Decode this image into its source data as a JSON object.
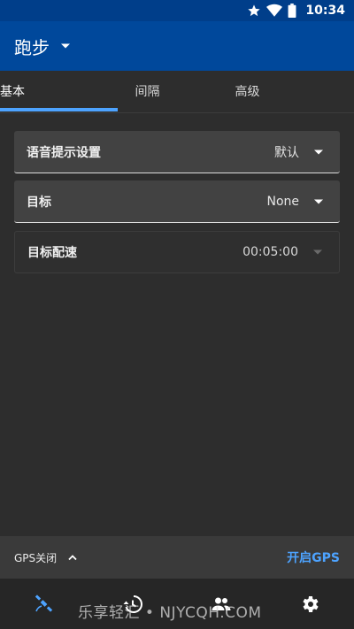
{
  "status_bar": {
    "time": "10:34",
    "icons": [
      "star-icon",
      "wifi-icon",
      "battery-icon"
    ]
  },
  "app_bar": {
    "title": "跑步",
    "caret_icon": "caret-down-icon"
  },
  "tabs": [
    {
      "label": "基本",
      "active": true
    },
    {
      "label": "间隔",
      "active": false
    },
    {
      "label": "高级",
      "active": false
    }
  ],
  "settings": [
    {
      "label": "语音提示设置",
      "value": "默认",
      "enabled": true
    },
    {
      "label": "目标",
      "value": "None",
      "enabled": true
    },
    {
      "label": "目标配速",
      "value": "00:05:00",
      "enabled": false
    }
  ],
  "gps_bar": {
    "status": "GPS关闭",
    "enable_label": "开启GPS"
  },
  "bottom_nav": {
    "items": [
      "satellite-icon",
      "history-icon",
      "people-icon",
      "settings-gear-icon"
    ]
  },
  "watermark": "乐享轻汇 • NJYCQH.COM",
  "colors": {
    "status_bar": "#003e8a",
    "app_bar": "#00489b",
    "accent": "#4da3ff",
    "background": "#2d2d2d",
    "card": "#424242"
  }
}
